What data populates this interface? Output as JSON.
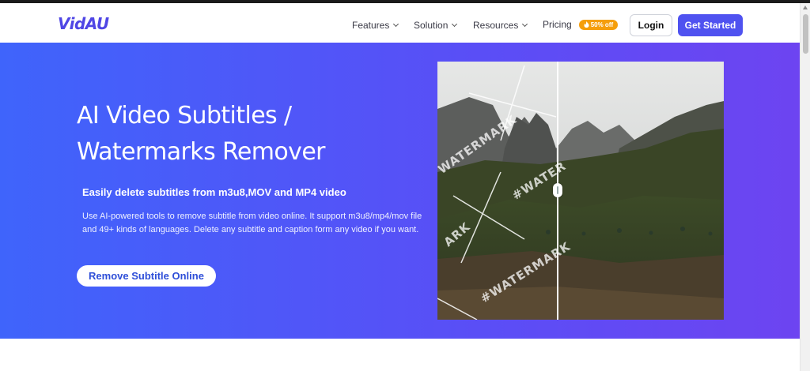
{
  "brand": {
    "logo_text": "VidAU",
    "accent": "#4f52f0",
    "hero_gradient": [
      "#3f64fb",
      "#6d44f1"
    ]
  },
  "nav": {
    "items": [
      {
        "label": "Features",
        "has_dropdown": true
      },
      {
        "label": "Solution",
        "has_dropdown": true
      },
      {
        "label": "Resources",
        "has_dropdown": true
      },
      {
        "label": "Pricing",
        "has_dropdown": false
      }
    ],
    "pricing_badge": "50% off",
    "pricing_badge_icon": "fire-icon",
    "login_label": "Login",
    "get_started_label": "Get Started"
  },
  "hero": {
    "title": "AI Video Subtitles / Watermarks Remover",
    "subtitle": "Easily delete subtitles from m3u8,MOV and MP4 video",
    "description": "Use AI-powered tools to remove subtitle from video online. It support m3u8/mp4/mov file and 49+ kinds of languages. Delete any subtitle and caption form any video if you want.",
    "cta_label": "Remove Subtitle Online"
  },
  "demo": {
    "watermarks": [
      "WATERMARK",
      "#WATER",
      "ARK",
      "#WATERMARK"
    ],
    "comparison_split": 0.42
  }
}
